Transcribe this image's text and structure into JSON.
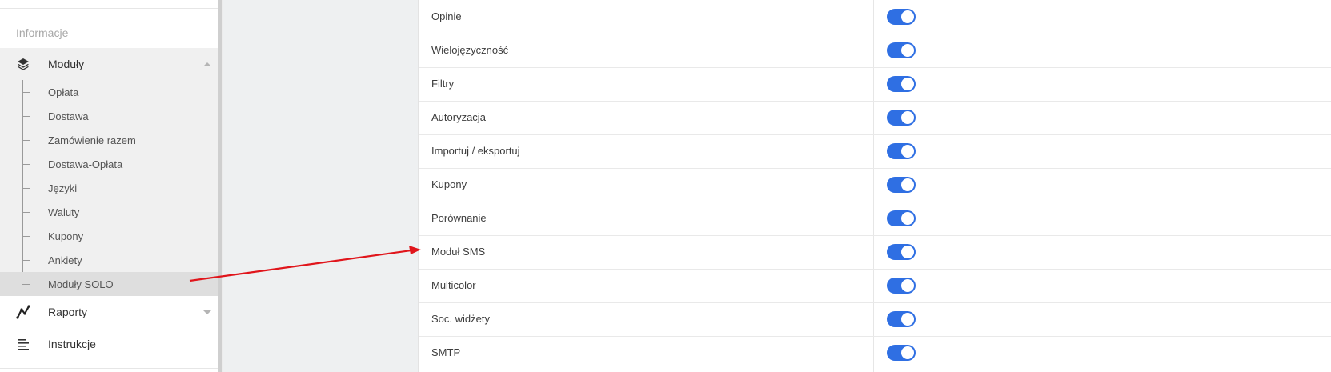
{
  "sidebar": {
    "section_label": "Informacje",
    "modules": {
      "label": "Moduły",
      "expanded": true,
      "icon": "layers-icon",
      "items": [
        {
          "label": "Opłata"
        },
        {
          "label": "Dostawa"
        },
        {
          "label": "Zamówienie razem"
        },
        {
          "label": "Dostawa-Opłata"
        },
        {
          "label": "Języki"
        },
        {
          "label": "Waluty"
        },
        {
          "label": "Kupony"
        },
        {
          "label": "Ankiety"
        },
        {
          "label": "Moduły SOLO",
          "active": true
        }
      ]
    },
    "reports": {
      "label": "Raporty",
      "icon": "chart-line-icon"
    },
    "instructions": {
      "label": "Instrukcje",
      "icon": "align-left-icon"
    }
  },
  "modules_table": {
    "rows": [
      {
        "name": "Opinie",
        "enabled": true
      },
      {
        "name": "Wielojęzyczność",
        "enabled": true
      },
      {
        "name": "Filtry",
        "enabled": true
      },
      {
        "name": "Autoryzacja",
        "enabled": true
      },
      {
        "name": "Importuj / eksportuj",
        "enabled": true
      },
      {
        "name": "Kupony",
        "enabled": true
      },
      {
        "name": "Porównanie",
        "enabled": true
      },
      {
        "name": "Moduł SMS",
        "enabled": true
      },
      {
        "name": "Multicolor",
        "enabled": true
      },
      {
        "name": "Soc. widżety",
        "enabled": true
      },
      {
        "name": "SMTP",
        "enabled": true
      }
    ]
  },
  "colors": {
    "toggle_on": "#2f6fe3",
    "annotation_arrow": "#e0151b",
    "active_item_bg": "#dedede"
  }
}
